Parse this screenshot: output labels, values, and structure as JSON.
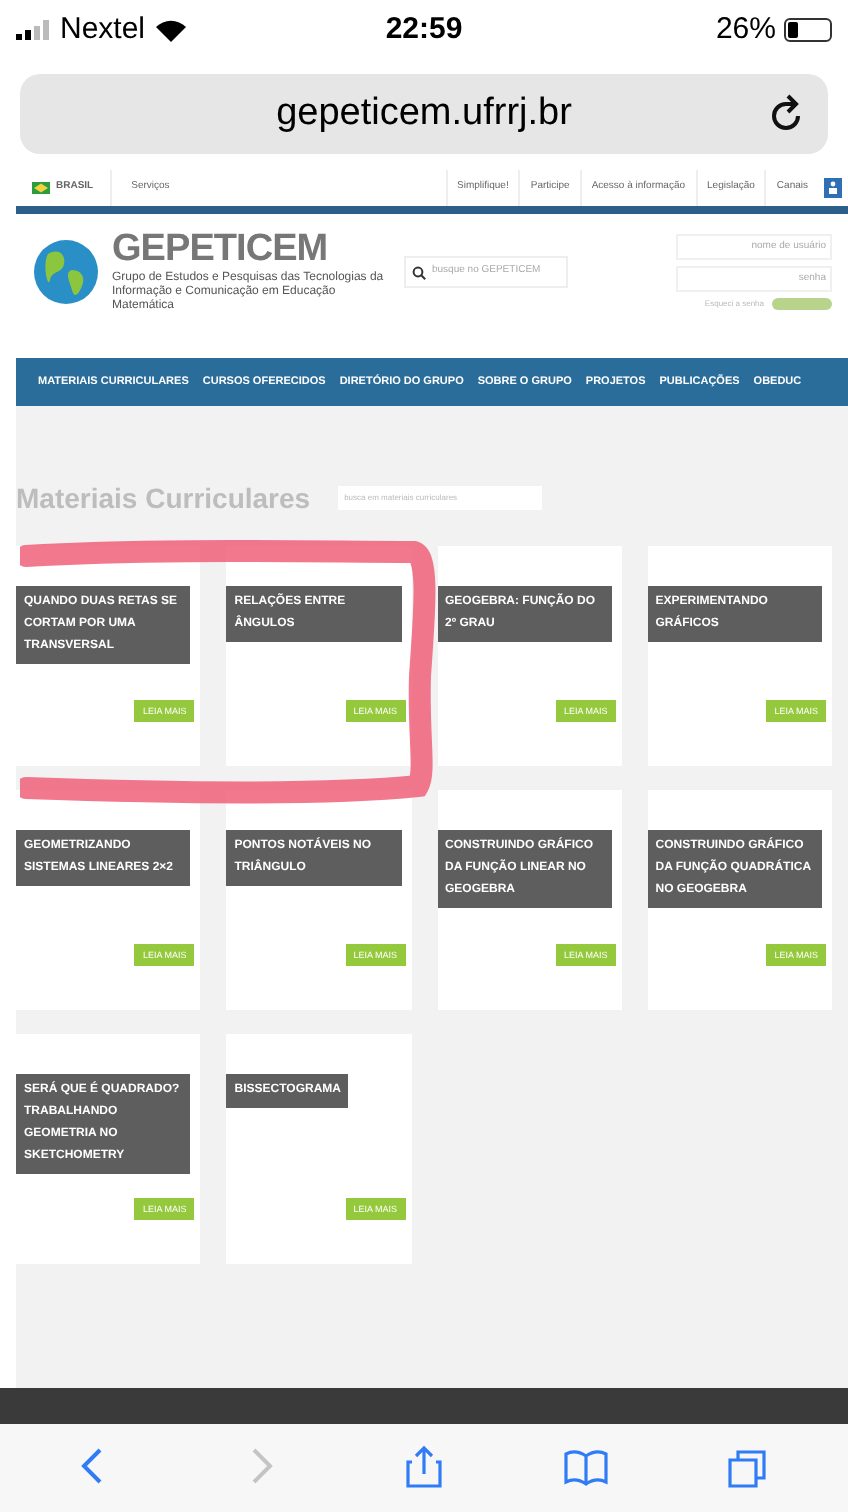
{
  "status_bar": {
    "carrier": "Nextel",
    "time": "22:59",
    "battery": "26%"
  },
  "address_bar": {
    "url": "gepeticem.ufrrj.br"
  },
  "gov_bar": {
    "country": "BRASIL",
    "left_links": [
      "Serviços"
    ],
    "right_links": [
      "Simplifique!",
      "Participe",
      "Acesso à informação",
      "Legislação",
      "Canais"
    ]
  },
  "header": {
    "logo": "GEPETICEM",
    "subtitle": "Grupo de Estudos e Pesquisas das Tecnologias da Informação e Comunicação em Educação Matemática",
    "search": {
      "placeholder": "busque no GEPETICEM"
    },
    "login": {
      "username_placeholder": "nome de usuário",
      "password_placeholder": "senha",
      "forgot": "Esqueci a senha"
    }
  },
  "nav": [
    "MATERIAIS CURRICULARES",
    "CURSOS OFERECIDOS",
    "DIRETÓRIO DO GRUPO",
    "SOBRE O GRUPO",
    "PROJETOS",
    "PUBLICAÇÕES",
    "OBEDUC"
  ],
  "section": {
    "title": "Materiais Curriculares",
    "search": {
      "placeholder": "busca em materiais curriculares"
    }
  },
  "cards": [
    {
      "title": "QUANDO DUAS RETAS SE CORTAM POR UMA TRANSVERSAL",
      "button": "LEIA MAIS"
    },
    {
      "title": "RELAÇÕES ENTRE ÂNGULOS",
      "button": "LEIA MAIS"
    },
    {
      "title": "GEOGEBRA: FUNÇÃO DO 2º GRAU",
      "button": "LEIA MAIS"
    },
    {
      "title": "EXPERIMENTANDO GRÁFICOS",
      "button": "LEIA MAIS"
    },
    {
      "title": "GEOMETRIZANDO SISTEMAS LINEARES 2×2",
      "button": "LEIA MAIS"
    },
    {
      "title": "PONTOS NOTÁVEIS NO TRIÂNGULO",
      "button": "LEIA MAIS"
    },
    {
      "title": "CONSTRUINDO GRÁFICO DA FUNÇÃO LINEAR NO GEOGEBRA",
      "button": "LEIA MAIS"
    },
    {
      "title": "CONSTRUINDO GRÁFICO DA FUNÇÃO QUADRÁTICA NO GEOGEBRA",
      "button": "LEIA MAIS"
    },
    {
      "title": "SERÁ QUE É QUADRADO? TRABALHANDO GEOMETRIA NO SKETCHOMETRY",
      "button": "LEIA MAIS"
    },
    {
      "title": "BISSECTOGRAMA",
      "button": "LEIA MAIS"
    }
  ],
  "toolbar": [
    {
      "kind": "back",
      "disabled": false
    },
    {
      "kind": "forward",
      "disabled": true
    },
    {
      "kind": "share",
      "disabled": false
    },
    {
      "kind": "bookmarks",
      "disabled": false
    },
    {
      "kind": "tabs",
      "disabled": false
    }
  ]
}
